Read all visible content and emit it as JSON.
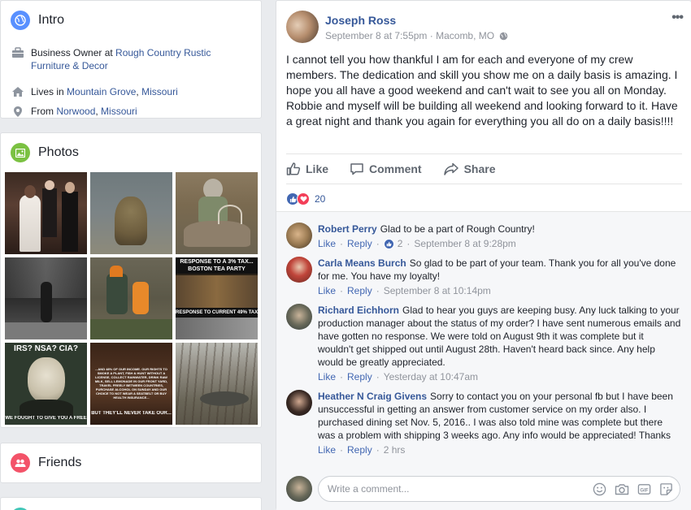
{
  "intro": {
    "title": "Intro",
    "work_prefix": "Business Owner at ",
    "work_place": "Rough Country Rustic Furniture & Decor",
    "lives_prefix": "Lives in ",
    "lives_city": "Mountain Grove",
    "lives_sep": ", ",
    "lives_state": "Missouri",
    "from_prefix": "From ",
    "from_city": "Norwood",
    "from_sep": ", ",
    "from_state": "Missouri"
  },
  "photos": {
    "title": "Photos",
    "overlay": {
      "p6_top": "RESPONSE TO A 3% TAX... BOSTON TEA PARTY",
      "p6_bottom": "RESPONSE TO CURRENT 49% TAX...",
      "p7_top": "IRS? NSA? CIA?",
      "p7_bottom": "WE FOUGHT TO GIVE YOU A FREE",
      "p8_text": "...AND 48% OF OUR INCOME. OUR RIGHTS TO SMOKE A PLANT, FISH & HUNT WITHOUT A LICENSE, COLLECT RAINWATER, DRINK RAW MILK, SELL LEMONADE IN OUR FRONT YARD, TRAVEL FREELY BETWEEN COUNTRIES, PURCHASE ALCOHOL ON SUNDAY AND OUR CHOICE TO NOT WEAR A SEATBELT OR BUY HEALTH INSURANCE...",
      "p8_bottom": "BUT THEY'LL NEVER TAKE OUR..."
    }
  },
  "friends": {
    "title": "Friends"
  },
  "post": {
    "author": "Joseph Ross",
    "date": "September 8 at 7:55pm",
    "sep": " · ",
    "location": "Macomb, MO",
    "more": "•••",
    "text": "I cannot tell you how thankful I am for each and everyone of my crew members. The dedication and skill you show me on a daily basis is amazing. I hope you all have a good weekend and can't wait to see you all on Monday. Robbie and myself will be building all weekend and looking forward to it. Have a great night and thank you again for everything you all do on a daily basis!!!!",
    "actions": {
      "like": "Like",
      "comment": "Comment",
      "share": "Share"
    },
    "reaction_count": "20"
  },
  "comments": [
    {
      "name": "Robert Perry",
      "text": "Glad to be a part of Rough Country!",
      "like": "Like",
      "reply": "Reply",
      "likes": "2",
      "time": "September 8 at 9:28pm"
    },
    {
      "name": "Carla Means Burch",
      "text": "So glad to be part of your team. Thank you for all you've done for me. You have my loyalty!",
      "like": "Like",
      "reply": "Reply",
      "time": "September 8 at 10:14pm"
    },
    {
      "name": "Richard Eichhorn",
      "text": "Glad to hear you guys are keeping busy. Any luck talking to your production manager about the status of my order? I have sent numerous emails and have gotten no response. We were told on August 9th it was complete but it wouldn't get shipped out until August 28th. Haven't heard back since. Any help would be greatly appreciated.",
      "like": "Like",
      "reply": "Reply",
      "time": "Yesterday at 10:47am"
    },
    {
      "name": "Heather N Craig Givens",
      "text": "Sorry to contact you on your personal fb but I have been unsuccessful in getting an answer from customer service on my order also. I purchased dining set Nov. 5, 2016.. I was also told mine was complete but there was a problem with shipping 3 weeks ago. Any info would be appreciated! Thanks",
      "like": "Like",
      "reply": "Reply",
      "time": "2 hrs"
    }
  ],
  "write_comment": {
    "placeholder": "Write a comment...",
    "gif": "GIF"
  },
  "colors": {
    "link": "#365899",
    "meta": "#90949c",
    "like_blue": "#4267b2",
    "love_red": "#f33e58",
    "intro_icon": "#5890ff",
    "photos_icon": "#7bc142",
    "friends_icon": "#f35369"
  }
}
